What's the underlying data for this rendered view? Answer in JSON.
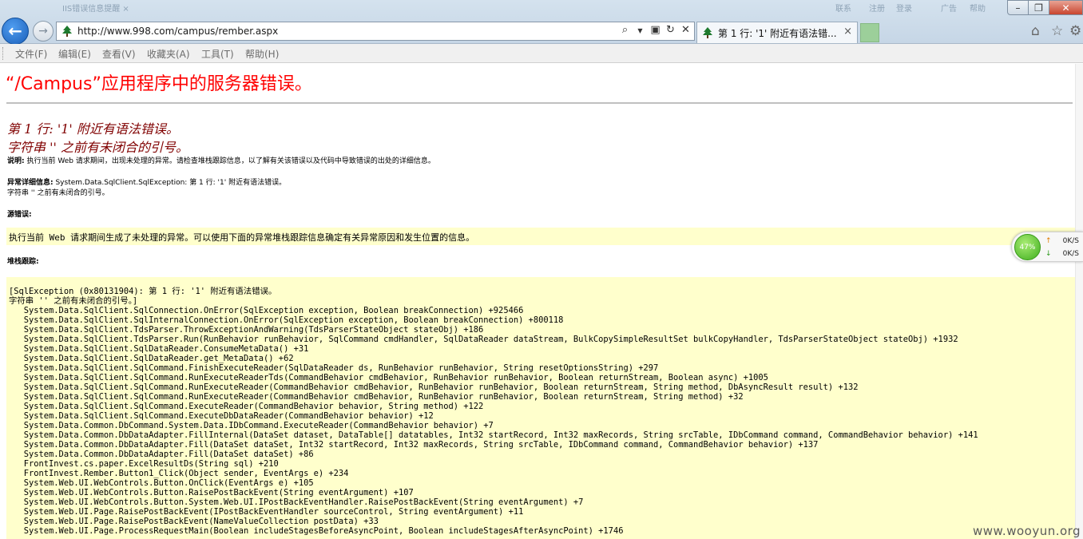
{
  "browser": {
    "url": "http://www.998.com/campus/rember.aspx",
    "tab_title": "第 1 行: '1' 附近有语法错...",
    "tab_close": "×",
    "background_tabs": [
      "IIS错误信息提醒 ×",
      "联系",
      "注册",
      "登录",
      "广告",
      "帮助"
    ],
    "accent_color": "#1b5fb9"
  },
  "menu": {
    "items": [
      "文件(F)",
      "编辑(E)",
      "查看(V)",
      "收藏夹(A)",
      "工具(T)",
      "帮助(H)"
    ]
  },
  "page": {
    "heading": "“/Campus”应用程序中的服务器错误。",
    "error_title_line1": "第 1 行: '1' 附近有语法错误。",
    "error_title_line2": "字符串 '' 之前有未闭合的引号。",
    "description_label": "说明:",
    "description_text": " 执行当前 Web 请求期间，出现未处理的异常。请检查堆栈跟踪信息，以了解有关该错误以及代码中导致错误的出处的详细信息。",
    "exception_label": "异常详细信息:",
    "exception_text": " System.Data.SqlClient.SqlException: 第 1 行: '1' 附近有语法错误。",
    "exception_text_line2": "字符串 '' 之前有未闭合的引号。",
    "source_error_label": "源错误:",
    "source_error_text": "执行当前 Web 请求期间生成了未处理的异常。可以使用下面的异常堆栈跟踪信息确定有关异常原因和发生位置的信息。",
    "stack_trace_label": "堆栈跟踪:",
    "stack_trace": "[SqlException (0x80131904): 第 1 行: '1' 附近有语法错误。\n字符串 '' 之前有未闭合的引号。]\n   System.Data.SqlClient.SqlConnection.OnError(SqlException exception, Boolean breakConnection) +925466\n   System.Data.SqlClient.SqlInternalConnection.OnError(SqlException exception, Boolean breakConnection) +800118\n   System.Data.SqlClient.TdsParser.ThrowExceptionAndWarning(TdsParserStateObject stateObj) +186\n   System.Data.SqlClient.TdsParser.Run(RunBehavior runBehavior, SqlCommand cmdHandler, SqlDataReader dataStream, BulkCopySimpleResultSet bulkCopyHandler, TdsParserStateObject stateObj) +1932\n   System.Data.SqlClient.SqlDataReader.ConsumeMetaData() +31\n   System.Data.SqlClient.SqlDataReader.get_MetaData() +62\n   System.Data.SqlClient.SqlCommand.FinishExecuteReader(SqlDataReader ds, RunBehavior runBehavior, String resetOptionsString) +297\n   System.Data.SqlClient.SqlCommand.RunExecuteReaderTds(CommandBehavior cmdBehavior, RunBehavior runBehavior, Boolean returnStream, Boolean async) +1005\n   System.Data.SqlClient.SqlCommand.RunExecuteReader(CommandBehavior cmdBehavior, RunBehavior runBehavior, Boolean returnStream, String method, DbAsyncResult result) +132\n   System.Data.SqlClient.SqlCommand.RunExecuteReader(CommandBehavior cmdBehavior, RunBehavior runBehavior, Boolean returnStream, String method) +32\n   System.Data.SqlClient.SqlCommand.ExecuteReader(CommandBehavior behavior, String method) +122\n   System.Data.SqlClient.SqlCommand.ExecuteDbDataReader(CommandBehavior behavior) +12\n   System.Data.Common.DbCommand.System.Data.IDbCommand.ExecuteReader(CommandBehavior behavior) +7\n   System.Data.Common.DbDataAdapter.FillInternal(DataSet dataset, DataTable[] datatables, Int32 startRecord, Int32 maxRecords, String srcTable, IDbCommand command, CommandBehavior behavior) +141\n   System.Data.Common.DbDataAdapter.Fill(DataSet dataSet, Int32 startRecord, Int32 maxRecords, String srcTable, IDbCommand command, CommandBehavior behavior) +137\n   System.Data.Common.DbDataAdapter.Fill(DataSet dataSet) +86\n   FrontInvest.cs.paper.ExcelResultDs(String sql) +210\n   FrontInvest.Rember.Button1_Click(Object sender, EventArgs e) +234\n   System.Web.UI.WebControls.Button.OnClick(EventArgs e) +105\n   System.Web.UI.WebControls.Button.RaisePostBackEvent(String eventArgument) +107\n   System.Web.UI.WebControls.Button.System.Web.UI.IPostBackEventHandler.RaisePostBackEvent(String eventArgument) +7\n   System.Web.UI.Page.RaisePostBackEvent(IPostBackEventHandler sourceControl, String eventArgument) +11\n   System.Web.UI.Page.RaisePostBackEvent(NameValueCollection postData) +33\n   System.Web.UI.Page.ProcessRequestMain(Boolean includeStagesBeforeAsyncPoint, Boolean includeStagesAfterAsyncPoint) +1746",
    "heading_color": "#ff0000",
    "error_title_color": "#800000",
    "code_background": "#ffffcc"
  },
  "speed_widget": {
    "percent": "47%",
    "upload": "0K/S",
    "download": "0K/S",
    "up_arrow": "↑",
    "down_arrow": "↓"
  },
  "watermark": "www.wooyun.org"
}
